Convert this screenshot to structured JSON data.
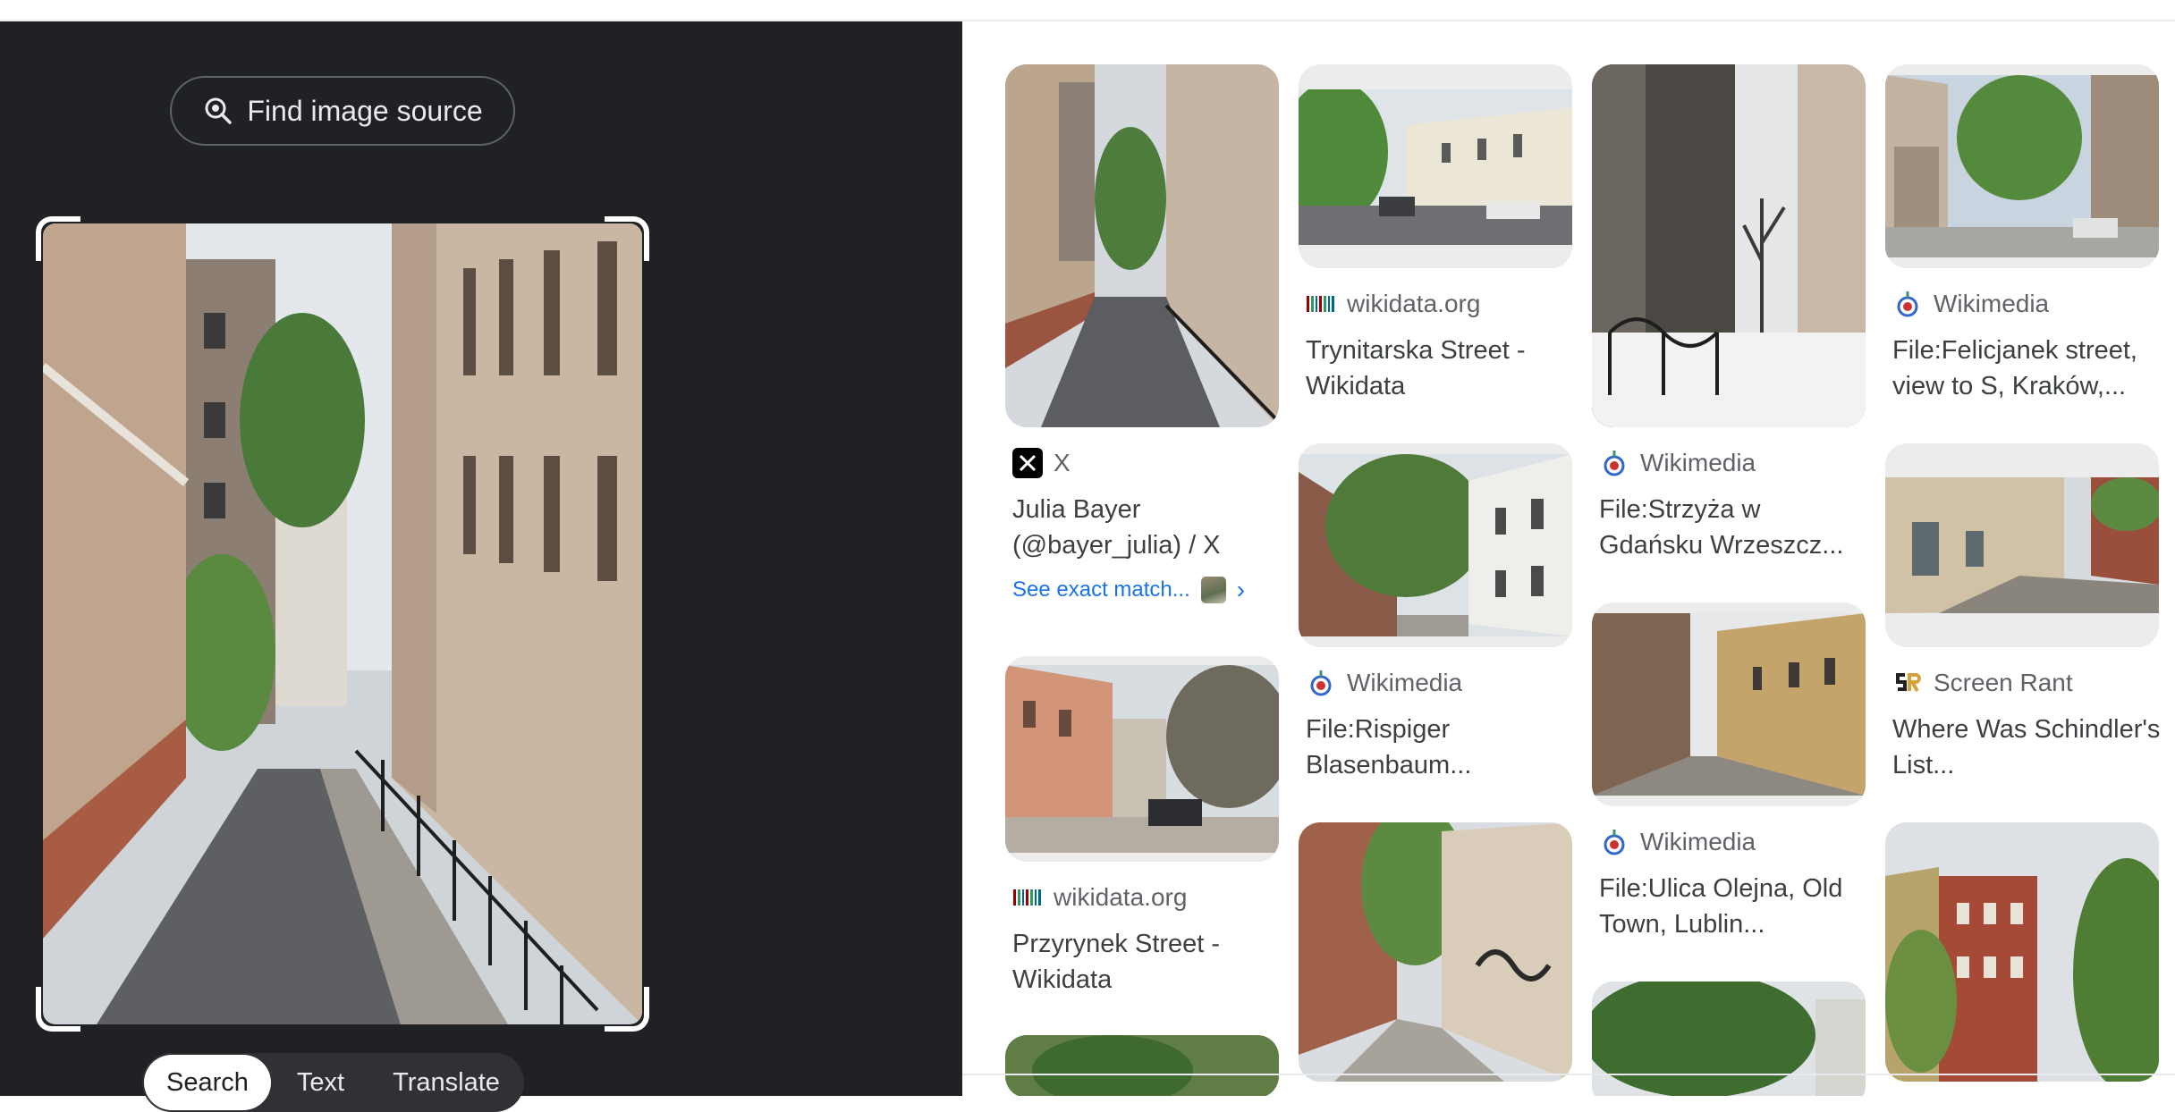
{
  "left": {
    "find_source": {
      "label": "Find image source",
      "icon": "lens-search-icon"
    },
    "tabs": [
      {
        "label": "Search",
        "active": true
      },
      {
        "label": "Text",
        "active": false
      },
      {
        "label": "Translate",
        "active": false
      }
    ]
  },
  "results": {
    "cards": [
      {
        "source": "X",
        "title": "Julia Bayer (@bayer_julia) / X",
        "exact_match": "See exact match...",
        "icon": "x-logo-icon"
      },
      {
        "source": "wikidata.org",
        "title": "Przyrynek Street - Wikidata",
        "icon": "wikidata-icon"
      },
      {
        "source": "wikidata.org",
        "title": "Trynitarska Street - Wikidata",
        "icon": "wikidata-icon"
      },
      {
        "source": "Wikimedia",
        "title": "File:Rispiger Blasenbaum...",
        "icon": "wikimedia-icon"
      },
      {
        "source": "Wikimedia",
        "title": "File:Strzyża w Gdańsku Wrzeszcz...",
        "icon": "wikimedia-icon"
      },
      {
        "source": "Wikimedia",
        "title": "File:Ulica Olejna, Old Town, Lublin...",
        "icon": "wikimedia-icon"
      },
      {
        "source": "Wikimedia",
        "title": "File:Felicjanek street, view to S, Kraków,...",
        "icon": "wikimedia-icon"
      },
      {
        "source": "Screen Rant",
        "title": "Where Was Schindler's List...",
        "icon": "screen-rant-icon"
      }
    ]
  },
  "colors": {
    "panel_bg": "#202124",
    "link_blue": "#1a73e8",
    "text_gray": "#5f6368"
  }
}
